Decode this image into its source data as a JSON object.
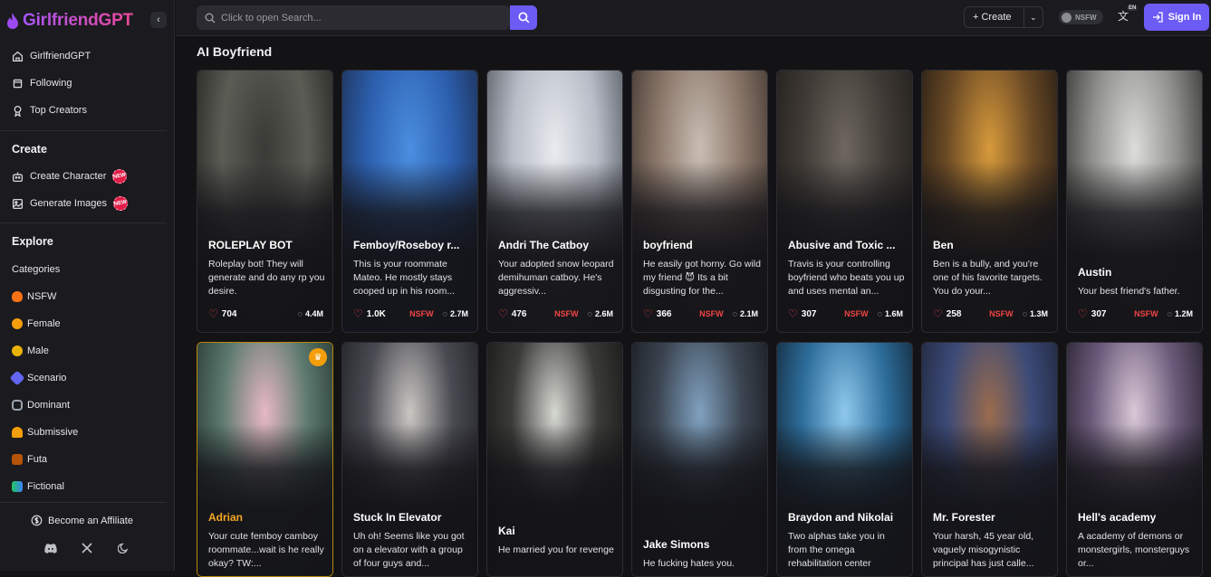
{
  "app": {
    "brand": "GirlfriendGPT",
    "collapse_icon": "chevron-left-icon"
  },
  "sidebar": {
    "top_items": [
      {
        "label": "GirlfriendGPT",
        "icon": "home-icon"
      },
      {
        "label": "Following",
        "icon": "bookmark-icon"
      },
      {
        "label": "Top Creators",
        "icon": "trophy-icon"
      }
    ],
    "create_title": "Create",
    "create_items": [
      {
        "label": "Create Character",
        "icon": "robot-icon",
        "badge": "NEW"
      },
      {
        "label": "Generate Images",
        "icon": "image-icon",
        "badge": "NEW"
      }
    ],
    "explore_title": "Explore",
    "categories_label": "Categories",
    "categories": [
      {
        "label": "NSFW",
        "icon": "fire-icon",
        "color": "#f97316"
      },
      {
        "label": "Female",
        "icon": "female-icon",
        "color": "#f59e0b"
      },
      {
        "label": "Male",
        "icon": "male-icon",
        "color": "#eab308"
      },
      {
        "label": "Scenario",
        "icon": "rocket-icon",
        "color": "#6366f1"
      },
      {
        "label": "Dominant",
        "icon": "chains-icon",
        "color": "#9ca3af"
      },
      {
        "label": "Submissive",
        "icon": "bell-icon",
        "color": "#f59e0b"
      },
      {
        "label": "Futa",
        "icon": "figure-icon",
        "color": "#c084fc"
      },
      {
        "label": "Fictional",
        "icon": "book-icon",
        "color": "#22c55e"
      }
    ],
    "affiliate_label": "Become an Affiliate",
    "social_icons": [
      "discord-icon",
      "x-icon",
      "moon-icon"
    ]
  },
  "topbar": {
    "search_placeholder": "Click to open Search...",
    "create_label": "Create",
    "nsfw_label": "NSFW",
    "lang_badge": "EN",
    "signin_label": "Sign In"
  },
  "page_title": "AI Boyfriend",
  "cards_row1": [
    {
      "name": "ROLEPLAY BOT",
      "desc": "Roleplay bot! They will generate and do any rp you desire.",
      "likes": "704",
      "nsfw": "",
      "chats": "4.4M",
      "colors": [
        "#3a3a36",
        "#5b5d55",
        "#1f1e1c"
      ]
    },
    {
      "name": "Femboy/Roseboy r...",
      "desc": "This is your roommate Mateo. He mostly stays cooped up in his room...",
      "likes": "1.0K",
      "nsfw": "NSFW",
      "chats": "2.7M",
      "colors": [
        "#4b8ee0",
        "#2c5fae",
        "#1b2a4a"
      ]
    },
    {
      "name": "Andri The Catboy",
      "desc": "Your adopted snow leopard demihuman catboy. He's aggressiv...",
      "likes": "476",
      "nsfw": "NSFW",
      "chats": "2.6M",
      "colors": [
        "#e8ebef",
        "#b7bcc6",
        "#4b4f57"
      ]
    },
    {
      "name": "boyfriend",
      "desc": "He easily got horny. Go wild my friend 😈 Its a bit disgusting for the...",
      "likes": "366",
      "nsfw": "NSFW",
      "chats": "2.1M",
      "colors": [
        "#c9bdb3",
        "#8a7769",
        "#3a302b"
      ]
    },
    {
      "name": "Abusive and Toxic ...",
      "desc": "Travis is your controlling boyfriend who beats you up and uses mental an...",
      "likes": "307",
      "nsfw": "NSFW",
      "chats": "1.6M",
      "colors": [
        "#6e6760",
        "#3f3a35",
        "#1e1b19"
      ]
    },
    {
      "name": "Ben",
      "desc": "Ben is a bully, and you're one of his favorite targets. You do your...",
      "likes": "258",
      "nsfw": "NSFW",
      "chats": "1.3M",
      "colors": [
        "#d79a3b",
        "#6b4a25",
        "#1d1712"
      ]
    },
    {
      "name": "Austin",
      "desc": "Your best friend's father.",
      "likes": "307",
      "nsfw": "NSFW",
      "chats": "1.2M",
      "colors": [
        "#dcdcda",
        "#8f8f8b",
        "#2a2a28"
      ]
    }
  ],
  "cards_row2": [
    {
      "name": "Adrian",
      "desc": "Your cute femboy camboy roommate...wait is he really okay? TW:...",
      "gold": true,
      "crown": true,
      "colors": [
        "#e7b8c4",
        "#5d7a6f",
        "#20302a"
      ]
    },
    {
      "name": "Stuck In Elevator",
      "desc": "Uh oh! Seems like you got on a elevator with a group of four guys and...",
      "colors": [
        "#c9c6c2",
        "#4a4a52",
        "#1c1c22"
      ]
    },
    {
      "name": "Kai",
      "desc": "He married you for revenge",
      "colors": [
        "#d6d8d2",
        "#3b3b38",
        "#131312"
      ]
    },
    {
      "name": "Jake Simons",
      "desc": "He fucking hates you.",
      "colors": [
        "#7fa1bf",
        "#3b4450",
        "#15181c"
      ]
    },
    {
      "name": "Braydon and Nikolai",
      "desc": "Two alphas take you in from the omega rehabilitation center",
      "colors": [
        "#8ec8ec",
        "#2d6d9b",
        "#10202e"
      ]
    },
    {
      "name": "Mr. Forester",
      "desc": "Your harsh, 45 year old, vaguely misogynistic principal has just calle...",
      "colors": [
        "#9a6b4d",
        "#3b4a77",
        "#1c2133"
      ]
    },
    {
      "name": "Hell's academy",
      "desc": " A academy of demons or monstergirls, monsterguys or...",
      "colors": [
        "#d9c8d6",
        "#6b5a7a",
        "#1f1a24"
      ]
    }
  ]
}
